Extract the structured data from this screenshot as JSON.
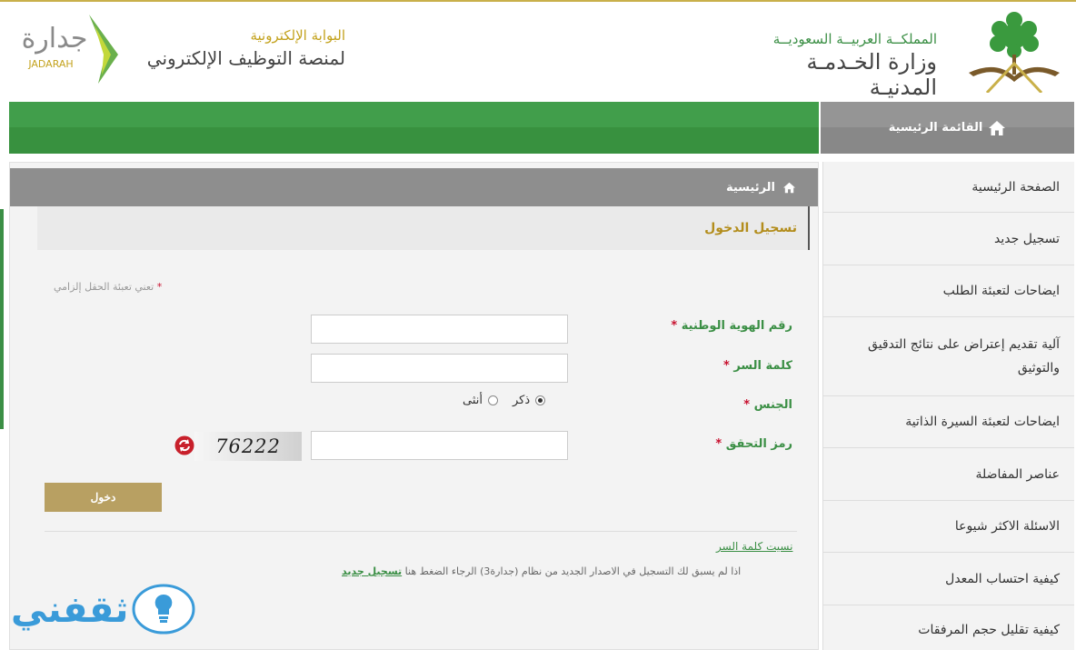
{
  "header": {
    "ministry_line1": "المملكــة العربيــة السعوديــة",
    "ministry_line2": "وزارة الخـدمـة المدنيـة",
    "jadarah_line1": "البوابة الإلكترونية",
    "jadarah_line2": "لمنصة التوظيف الإلكتروني",
    "jadarah_logo_ar": "جدارة",
    "jadarah_logo_en": "JADARAH"
  },
  "nav": {
    "main_menu_label": "القائمة الرئيسية"
  },
  "sidebar": {
    "items": [
      {
        "label": "الصفحة الرئيسية"
      },
      {
        "label": "تسجيل جديد"
      },
      {
        "label": "ايضاحات لتعبئة الطلب"
      },
      {
        "label": "آلية تقديم إعتراض على نتائج التدقيق والتوثيق"
      },
      {
        "label": "ايضاحات لتعبئة السيرة الذاتية"
      },
      {
        "label": "عناصر المفاضلة"
      },
      {
        "label": "الاسئلة الاكثر شيوعا"
      },
      {
        "label": "كيفية احتساب المعدل"
      },
      {
        "label": "كيفية تقليل حجم المرفقات"
      }
    ]
  },
  "breadcrumb": {
    "home_label": "الرئيسية"
  },
  "login": {
    "title": "تسجيل الدخول",
    "required_star": "*",
    "required_note": "تعني تعبئة الحقل إلزامي",
    "national_id_label": "رقم الهوية الوطنية",
    "national_id_value": "",
    "password_label": "كلمة السر",
    "password_value": "",
    "gender_label": "الجنس",
    "gender_male": "ذكر",
    "gender_female": "أنثى",
    "gender_selected": "male",
    "captcha_label": "رمز التحقق",
    "captcha_value": "",
    "captcha_code": "76222",
    "submit_label": "دخول",
    "forgot_password": "نسيت كلمة السر",
    "register_note": "اذا لم يسبق لك التسجيل في الاصدار الجديد من نظام (جدارة3) الرجاء الضغط هنا",
    "register_link": "تسجيل جديد"
  },
  "watermark": {
    "text": "ثقفني"
  },
  "colors": {
    "green": "#419e4b",
    "gold": "#b8a062",
    "gray_bar": "#8e8e8e",
    "required": "#c8102e"
  }
}
